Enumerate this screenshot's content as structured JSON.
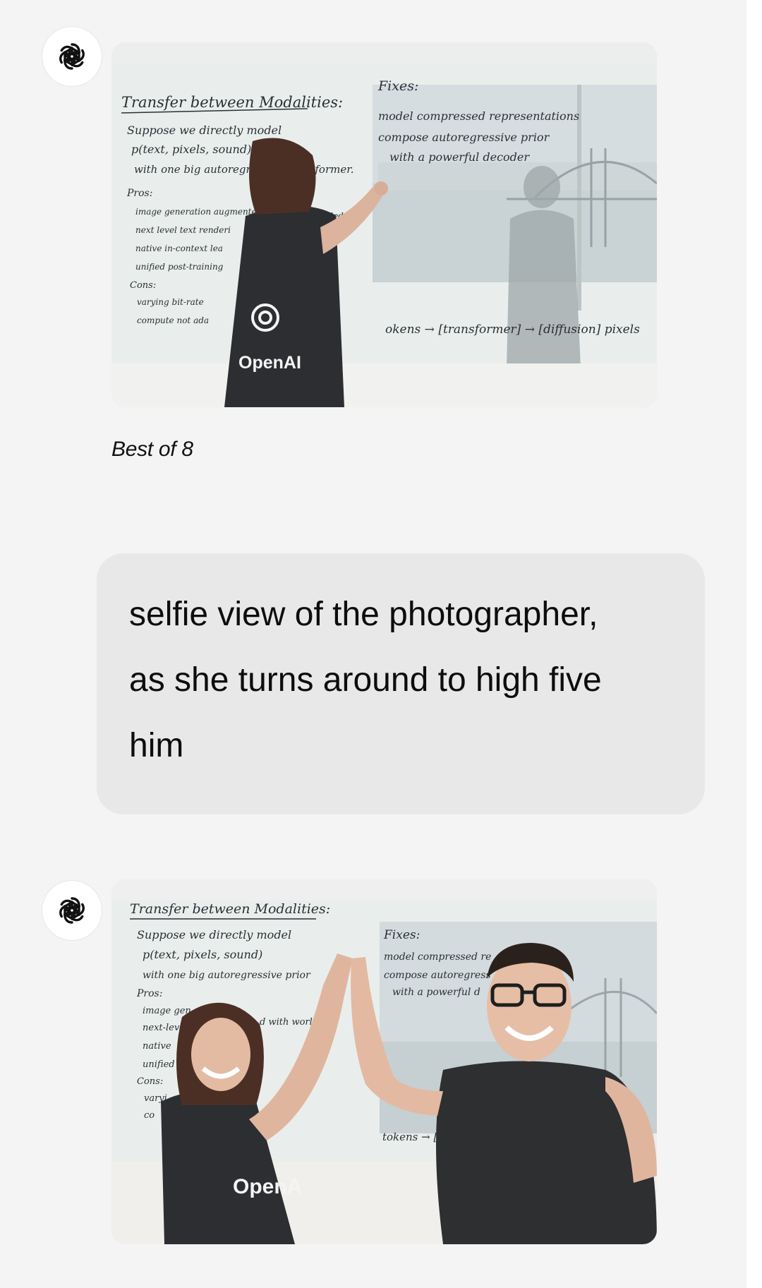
{
  "messages": [
    {
      "role": "assistant",
      "image": {
        "whiteboard": {
          "title": "Transfer between Modalities:",
          "lines": [
            "Suppose we directly model",
            "p(text, pixels, sound)",
            "with one big autoregressive transformer."
          ],
          "pros_label": "Pros:",
          "pros": [
            "image generation augmente",
            "next level text renderi",
            "native in-context lea",
            "unified post-training"
          ],
          "pros_tail": "nowledge",
          "cons_label": "Cons:",
          "cons": [
            "varying bit-rate",
            "compute not ada"
          ],
          "fixes_label": "Fixes:",
          "fixes": [
            "model compressed representations",
            "compose autoregressive prior",
            "with a powerful decoder"
          ],
          "flow": "okens → [transformer] → [diffusion] pixels"
        },
        "shirt_text": "OpenAI"
      },
      "caption": "Best of 8"
    },
    {
      "role": "user",
      "text": "selfie view of the photographer, as she turns around to high five him"
    },
    {
      "role": "assistant",
      "image": {
        "whiteboard": {
          "title": "Transfer between Modalities:",
          "lines": [
            "Suppose we directly model",
            "p(text, pixels, sound)",
            "with one big autoregressive prior"
          ],
          "pros_label": "Pros:",
          "pros": [
            "image gen",
            "next-lev",
            "native",
            "unified"
          ],
          "pros_tail": "d with world kno",
          "cons_label": "Cons:",
          "cons": [
            "varyi",
            "co"
          ],
          "fixes_label": "Fixes:",
          "fixes": [
            "model compressed re",
            "compose autoregress",
            "with a powerful d"
          ],
          "flow": "tokens → [transfo"
        },
        "shirt_text": "OpenA"
      }
    }
  ],
  "colors": {
    "page_background": "#f4f4f4",
    "bubble_background": "#e8e8e8",
    "avatar_background": "#ffffff",
    "text": "#0d0d0d"
  },
  "icons": {
    "assistant_avatar": "openai-logo-icon"
  }
}
